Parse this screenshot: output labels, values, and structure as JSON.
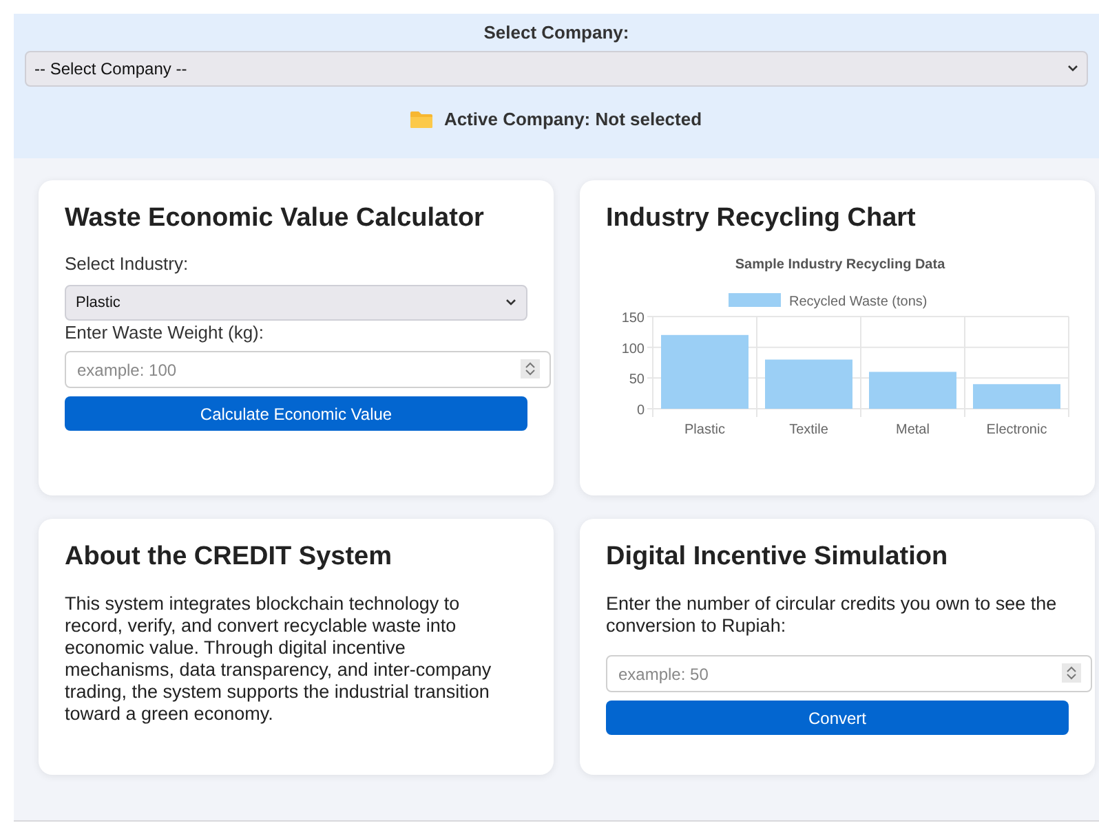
{
  "company_panel": {
    "label": "Select Company:",
    "select_value": "-- Select Company --",
    "active_company": "Active Company: Not selected"
  },
  "calculator": {
    "title": "Waste Economic Value Calculator",
    "industry_label": "Select Industry:",
    "industry_value": "Plastic",
    "weight_label": "Enter Waste Weight (kg):",
    "weight_placeholder": "example: 100",
    "button": "Calculate Economic Value"
  },
  "chart_card": {
    "title": "Industry Recycling Chart",
    "chart_data": {
      "type": "bar",
      "title": "Sample Industry Recycling Data",
      "categories": [
        "Plastic",
        "Textile",
        "Metal",
        "Electronic"
      ],
      "series": [
        {
          "name": "Recycled Waste (tons)",
          "color": "#9bcff5",
          "values": [
            120,
            80,
            60,
            40
          ]
        }
      ],
      "ylim": [
        0,
        150
      ],
      "yticks": [
        0,
        50,
        100,
        150
      ]
    }
  },
  "about": {
    "title": "About the CREDIT System",
    "text": "This system integrates blockchain technology to record, verify, and convert recyclable waste into economic value. Through digital incentive mechanisms, data transparency, and inter-company trading, the system supports the industrial transition toward a green economy."
  },
  "incentive": {
    "title": "Digital Incentive Simulation",
    "prompt": "Enter the number of circular credits you own to see the conversion to Rupiah:",
    "placeholder": "example: 50",
    "button": "Convert"
  }
}
